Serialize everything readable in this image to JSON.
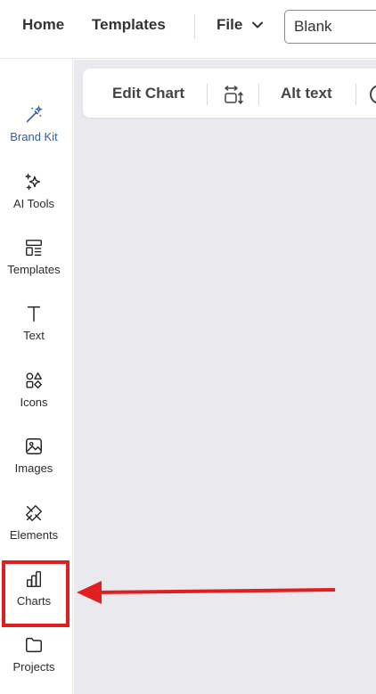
{
  "topbar": {
    "home_label": "Home",
    "templates_label": "Templates",
    "file_label": "File",
    "document_name": "Blank"
  },
  "sidebar": {
    "items": [
      {
        "label": "Brand Kit",
        "icon": "magic-wand-icon"
      },
      {
        "label": "AI Tools",
        "icon": "sparkles-icon"
      },
      {
        "label": "Templates",
        "icon": "templates-icon"
      },
      {
        "label": "Text",
        "icon": "text-icon"
      },
      {
        "label": "Icons",
        "icon": "shapes-icon"
      },
      {
        "label": "Images",
        "icon": "image-icon"
      },
      {
        "label": "Elements",
        "icon": "elements-icon"
      },
      {
        "label": "Charts",
        "icon": "bar-chart-icon"
      },
      {
        "label": "Projects",
        "icon": "folder-icon"
      }
    ]
  },
  "toolbar": {
    "edit_chart_label": "Edit Chart",
    "alt_text_label": "Alt text"
  },
  "colors": {
    "brand_kit": "#2b5fa8",
    "canvas_bg": "#e9e9ee",
    "annotation_red": "#e02020"
  }
}
